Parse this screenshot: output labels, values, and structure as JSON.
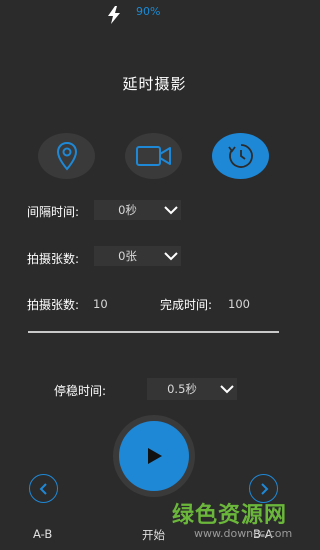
{
  "status": {
    "battery": "90%",
    "icon": "lightning-bolt-icon"
  },
  "title": "延时摄影",
  "modes": [
    {
      "name": "location",
      "icon": "location-pin-icon",
      "active": false
    },
    {
      "name": "video",
      "icon": "video-camera-icon",
      "active": false
    },
    {
      "name": "timelapse",
      "icon": "timelapse-clock-icon",
      "active": true
    }
  ],
  "interval": {
    "label": "间隔时间:",
    "value": "0秒"
  },
  "shot_count": {
    "label": "拍摄张数:",
    "value": "0张"
  },
  "summary": {
    "shots_label": "拍摄张数:",
    "shots_value": "10",
    "done_label": "完成时间:",
    "done_value": "100"
  },
  "progress": 0,
  "settle": {
    "label": "停稳时间:",
    "value": "0.5秒"
  },
  "controls": {
    "prev_label": "A-B",
    "start_label": "开始",
    "next_label": "B-A"
  },
  "watermark": {
    "text": "绿色资源网",
    "url": "www.downcc.com"
  },
  "colors": {
    "accent": "#1e88d6",
    "background": "#2b2b2b",
    "watermark": "#6fbf3c"
  }
}
